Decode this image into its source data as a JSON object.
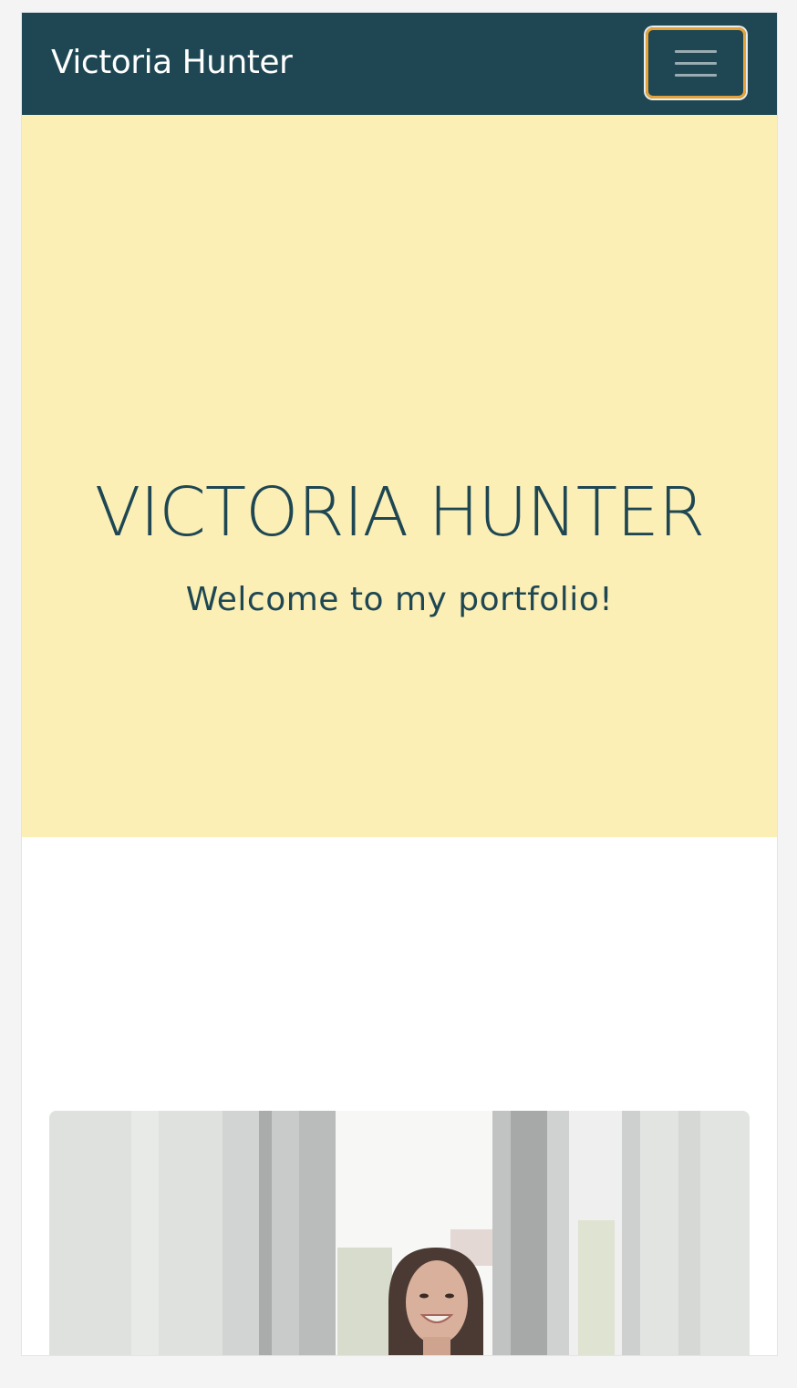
{
  "navbar": {
    "brand": "Victoria Hunter",
    "toggler_icon": "hamburger-icon"
  },
  "hero": {
    "title": "VICTORIA HUNTER",
    "subtitle": "Welcome to my portfolio!"
  },
  "colors": {
    "navbar_bg": "#1e4753",
    "hero_bg": "#fbefb6",
    "accent_focus": "#e3a23a",
    "text_primary": "#1e4753"
  }
}
